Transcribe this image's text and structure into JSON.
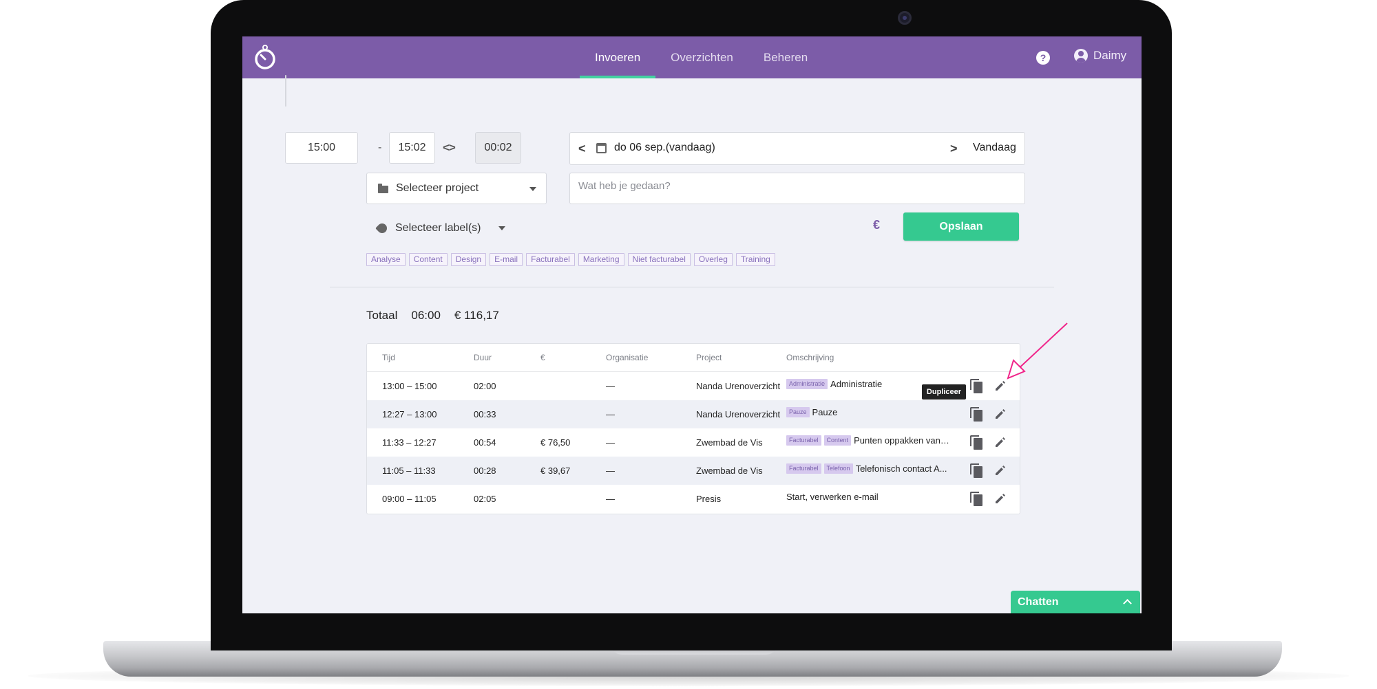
{
  "nav": {
    "tabs": [
      {
        "label": "Invoeren",
        "active": true
      },
      {
        "label": "Overzichten",
        "active": false
      },
      {
        "label": "Beheren",
        "active": false
      }
    ],
    "help_icon": "question-circle-icon",
    "user_name": "Daimy"
  },
  "entry": {
    "start_time": "15:00",
    "end_time": "15:02",
    "separator": "-",
    "swap_symbol": "<>",
    "duration": "00:02",
    "date": "do 06 sep.(vandaag)",
    "today_label": "Vandaag",
    "project_placeholder": "Selecteer project",
    "description_placeholder": "Wat heb je gedaan?",
    "label_placeholder": "Selecteer label(s)",
    "billable_symbol": "€",
    "save_label": "Opslaan"
  },
  "quick_tags": [
    "Analyse",
    "Content",
    "Design",
    "E-mail",
    "Facturabel",
    "Marketing",
    "Niet facturabel",
    "Overleg",
    "Training"
  ],
  "totals": {
    "label": "Totaal",
    "duration": "06:00",
    "amount": "€ 116,17"
  },
  "table": {
    "headers": [
      "Tijd",
      "Duur",
      "€",
      "Organisatie",
      "Project",
      "Omschrijving"
    ],
    "tooltip": "Dupliceer",
    "rows": [
      {
        "time": "13:00 – 15:00",
        "duration": "02:00",
        "amount": "",
        "organisation": "—",
        "project": "Nanda Urenoverzicht",
        "tags": [
          "Administratie"
        ],
        "description": "Administratie"
      },
      {
        "time": "12:27 – 13:00",
        "duration": "00:33",
        "amount": "",
        "organisation": "—",
        "project": "Nanda Urenoverzicht",
        "tags": [
          "Pauze"
        ],
        "description": "Pauze"
      },
      {
        "time": "11:33 – 12:27",
        "duration": "00:54",
        "amount": "€ 76,50",
        "organisation": "—",
        "project": "Zwembad de Vis",
        "tags": [
          "Facturabel",
          "Content"
        ],
        "description": "Punten oppakken van ..."
      },
      {
        "time": "11:05 – 11:33",
        "duration": "00:28",
        "amount": "€ 39,67",
        "organisation": "—",
        "project": "Zwembad de Vis",
        "tags": [
          "Facturabel",
          "Telefoon"
        ],
        "description": "Telefonisch contact A..."
      },
      {
        "time": "09:00 – 11:05",
        "duration": "02:05",
        "amount": "",
        "organisation": "—",
        "project": "Presis",
        "tags": [],
        "description": "Start, verwerken e-mail"
      }
    ]
  },
  "chat": {
    "label": "Chatten"
  },
  "colors": {
    "header": "#7c5ca8",
    "accent": "#35c990",
    "annotation_arrow": "#f0258a"
  }
}
